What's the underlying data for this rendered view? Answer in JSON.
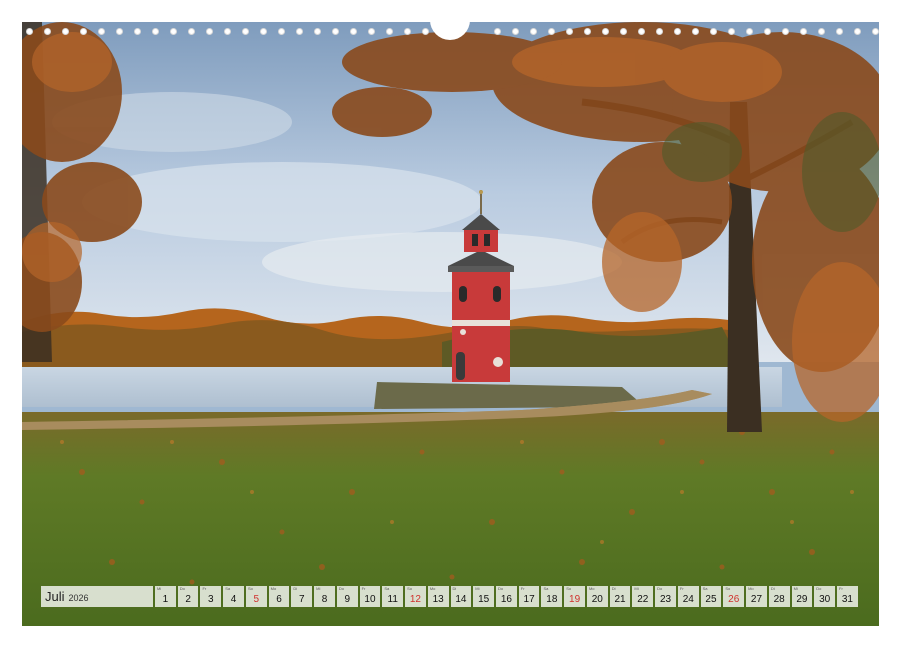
{
  "calendar": {
    "month": "Juli",
    "year": "2026",
    "days": [
      {
        "wd": "Mi",
        "num": "1",
        "sunday": false
      },
      {
        "wd": "Do",
        "num": "2",
        "sunday": false
      },
      {
        "wd": "Fr",
        "num": "3",
        "sunday": false
      },
      {
        "wd": "Sa",
        "num": "4",
        "sunday": false
      },
      {
        "wd": "So",
        "num": "5",
        "sunday": true
      },
      {
        "wd": "Mo",
        "num": "6",
        "sunday": false
      },
      {
        "wd": "Di",
        "num": "7",
        "sunday": false
      },
      {
        "wd": "Mi",
        "num": "8",
        "sunday": false
      },
      {
        "wd": "Do",
        "num": "9",
        "sunday": false
      },
      {
        "wd": "Fr",
        "num": "10",
        "sunday": false
      },
      {
        "wd": "Sa",
        "num": "11",
        "sunday": false
      },
      {
        "wd": "So",
        "num": "12",
        "sunday": true
      },
      {
        "wd": "Mo",
        "num": "13",
        "sunday": false
      },
      {
        "wd": "Di",
        "num": "14",
        "sunday": false
      },
      {
        "wd": "Mi",
        "num": "15",
        "sunday": false
      },
      {
        "wd": "Do",
        "num": "16",
        "sunday": false
      },
      {
        "wd": "Fr",
        "num": "17",
        "sunday": false
      },
      {
        "wd": "Sa",
        "num": "18",
        "sunday": false
      },
      {
        "wd": "So",
        "num": "19",
        "sunday": true
      },
      {
        "wd": "Mo",
        "num": "20",
        "sunday": false
      },
      {
        "wd": "Di",
        "num": "21",
        "sunday": false
      },
      {
        "wd": "Mi",
        "num": "22",
        "sunday": false
      },
      {
        "wd": "Do",
        "num": "23",
        "sunday": false
      },
      {
        "wd": "Fr",
        "num": "24",
        "sunday": false
      },
      {
        "wd": "Sa",
        "num": "25",
        "sunday": false
      },
      {
        "wd": "So",
        "num": "26",
        "sunday": true
      },
      {
        "wd": "Mo",
        "num": "27",
        "sunday": false
      },
      {
        "wd": "Di",
        "num": "28",
        "sunday": false
      },
      {
        "wd": "Mi",
        "num": "29",
        "sunday": false
      },
      {
        "wd": "Do",
        "num": "30",
        "sunday": false
      },
      {
        "wd": "Fr",
        "num": "31",
        "sunday": false
      }
    ]
  },
  "colors": {
    "sunday": "#d0312d",
    "lighthouse_red": "#c83a3a",
    "grass": "#4f6f23",
    "foliage": "#c0641e"
  }
}
